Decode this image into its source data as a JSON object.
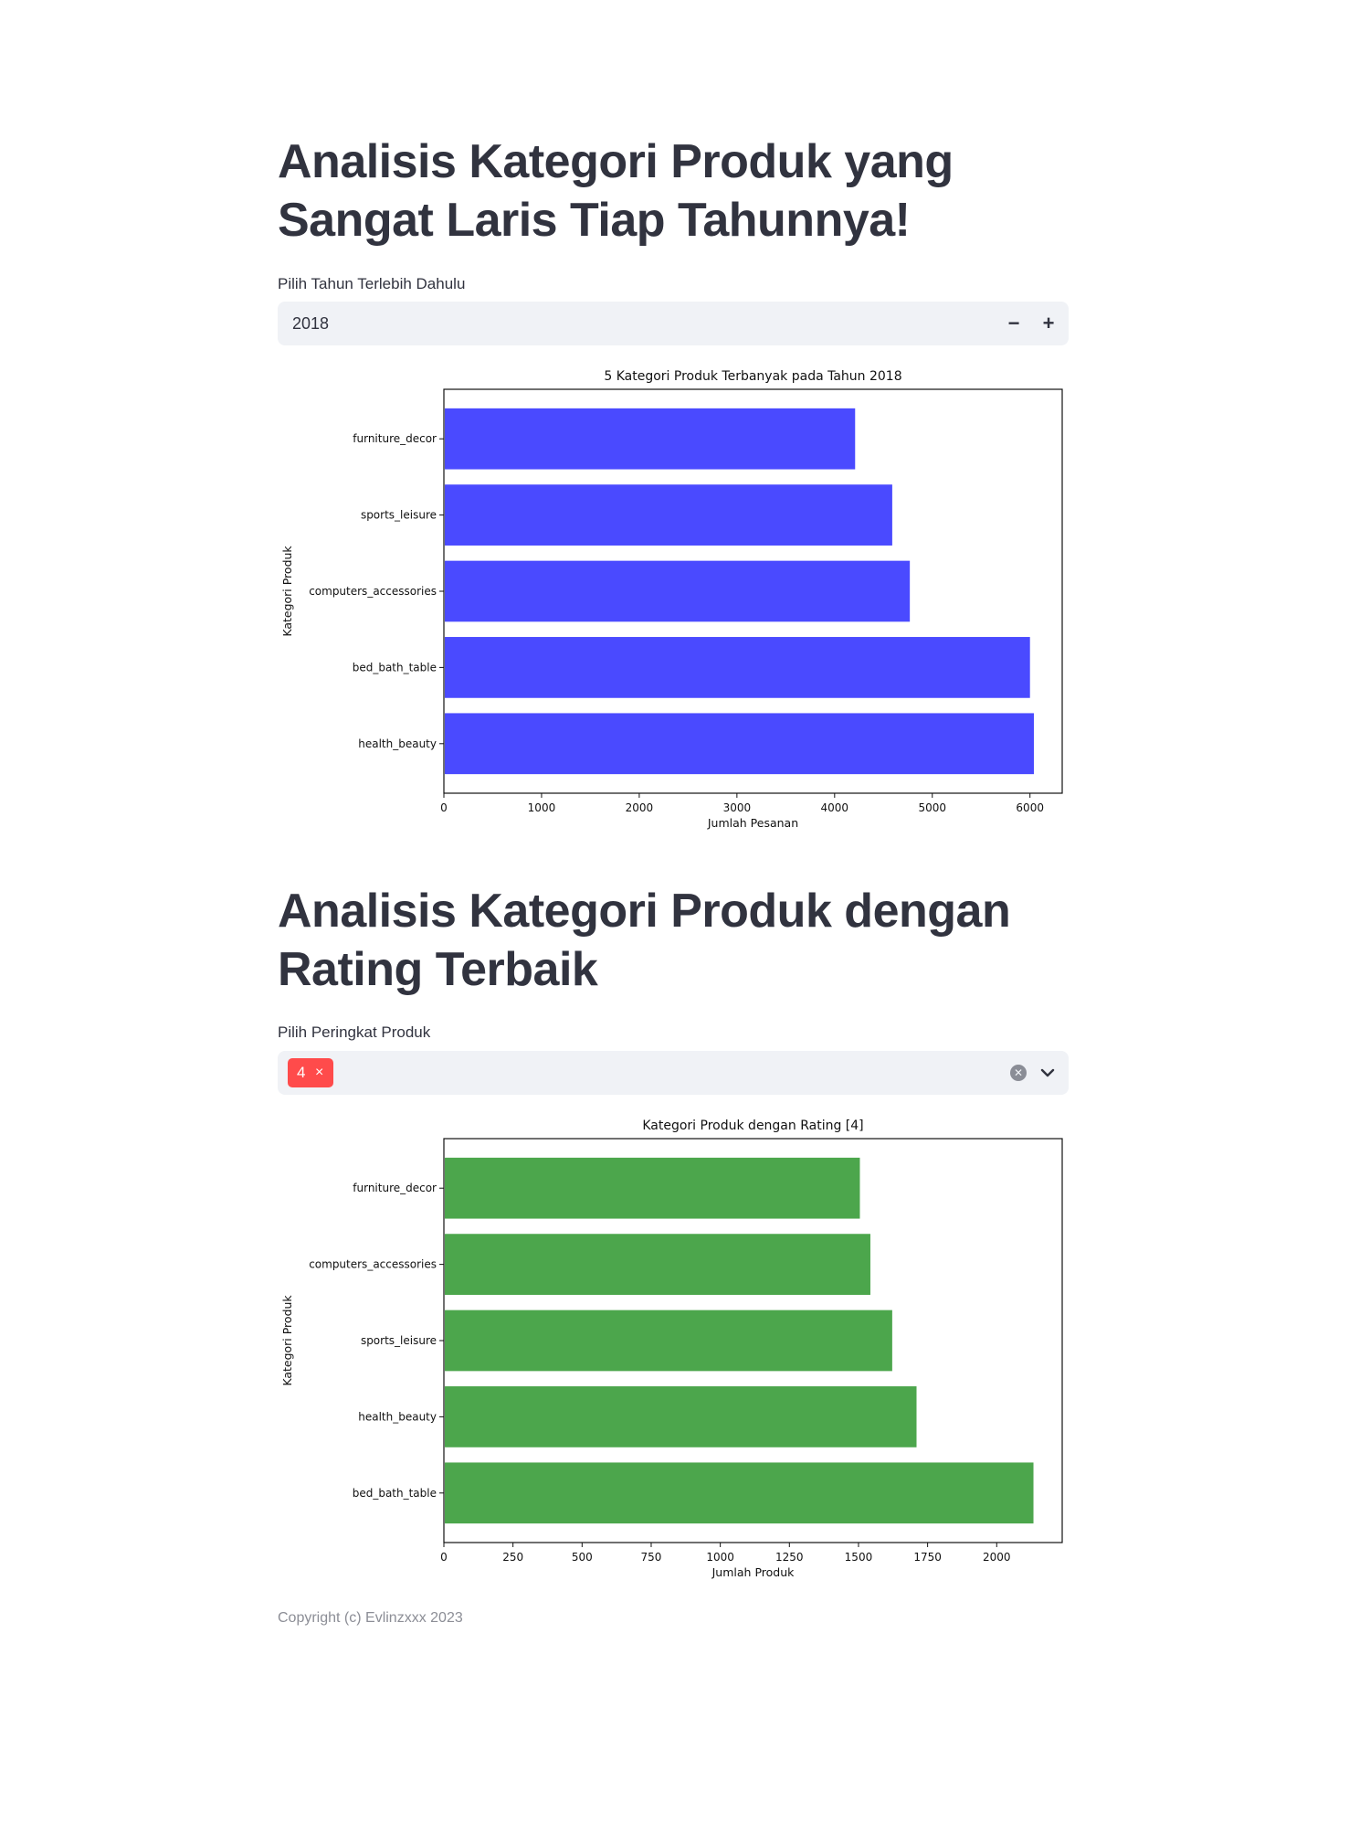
{
  "section1": {
    "title": "Analisis Kategori Produk yang Sangat Laris Tiap Tahunnya!",
    "year_label": "Pilih Tahun Terlebih Dahulu",
    "year_value": "2018",
    "minus_label": "−",
    "plus_label": "+"
  },
  "section2": {
    "title": "Analisis Kategori Produk dengan Rating Terbaik",
    "rating_label": "Pilih Peringkat Produk",
    "selected_tag": "4",
    "tag_remove": "×",
    "clear_icon": "x-circle-icon",
    "dropdown_icon": "chevron-down-icon"
  },
  "footer": {
    "text": "Copyright (c) Evlinzxxx 2023"
  },
  "chart_data": [
    {
      "type": "bar",
      "orientation": "horizontal",
      "title": "5 Kategori Produk Terbanyak pada Tahun 2018",
      "xlabel": "Jumlah Pesanan",
      "ylabel": "Kategori Produk",
      "categories": [
        "furniture_decor",
        "sports_leisure",
        "computers_accessories",
        "bed_bath_table",
        "health_beauty"
      ],
      "values": [
        4210,
        4590,
        4770,
        6000,
        6040
      ],
      "xlim": [
        0,
        6330
      ],
      "xticks": [
        0,
        1000,
        2000,
        3000,
        4000,
        5000,
        6000
      ],
      "color": "#4a4aff",
      "grid": false
    },
    {
      "type": "bar",
      "orientation": "horizontal",
      "title": "Kategori Produk dengan Rating [4]",
      "xlabel": "Jumlah Produk",
      "ylabel": "Kategori Produk",
      "categories": [
        "furniture_decor",
        "computers_accessories",
        "sports_leisure",
        "health_beauty",
        "bed_bath_table"
      ],
      "values": [
        1505,
        1543,
        1622,
        1710,
        2133
      ],
      "xlim": [
        0,
        2237
      ],
      "xticks": [
        0,
        250,
        500,
        750,
        1000,
        1250,
        1500,
        1750,
        2000
      ],
      "color": "#4ca64c",
      "grid": false
    }
  ]
}
